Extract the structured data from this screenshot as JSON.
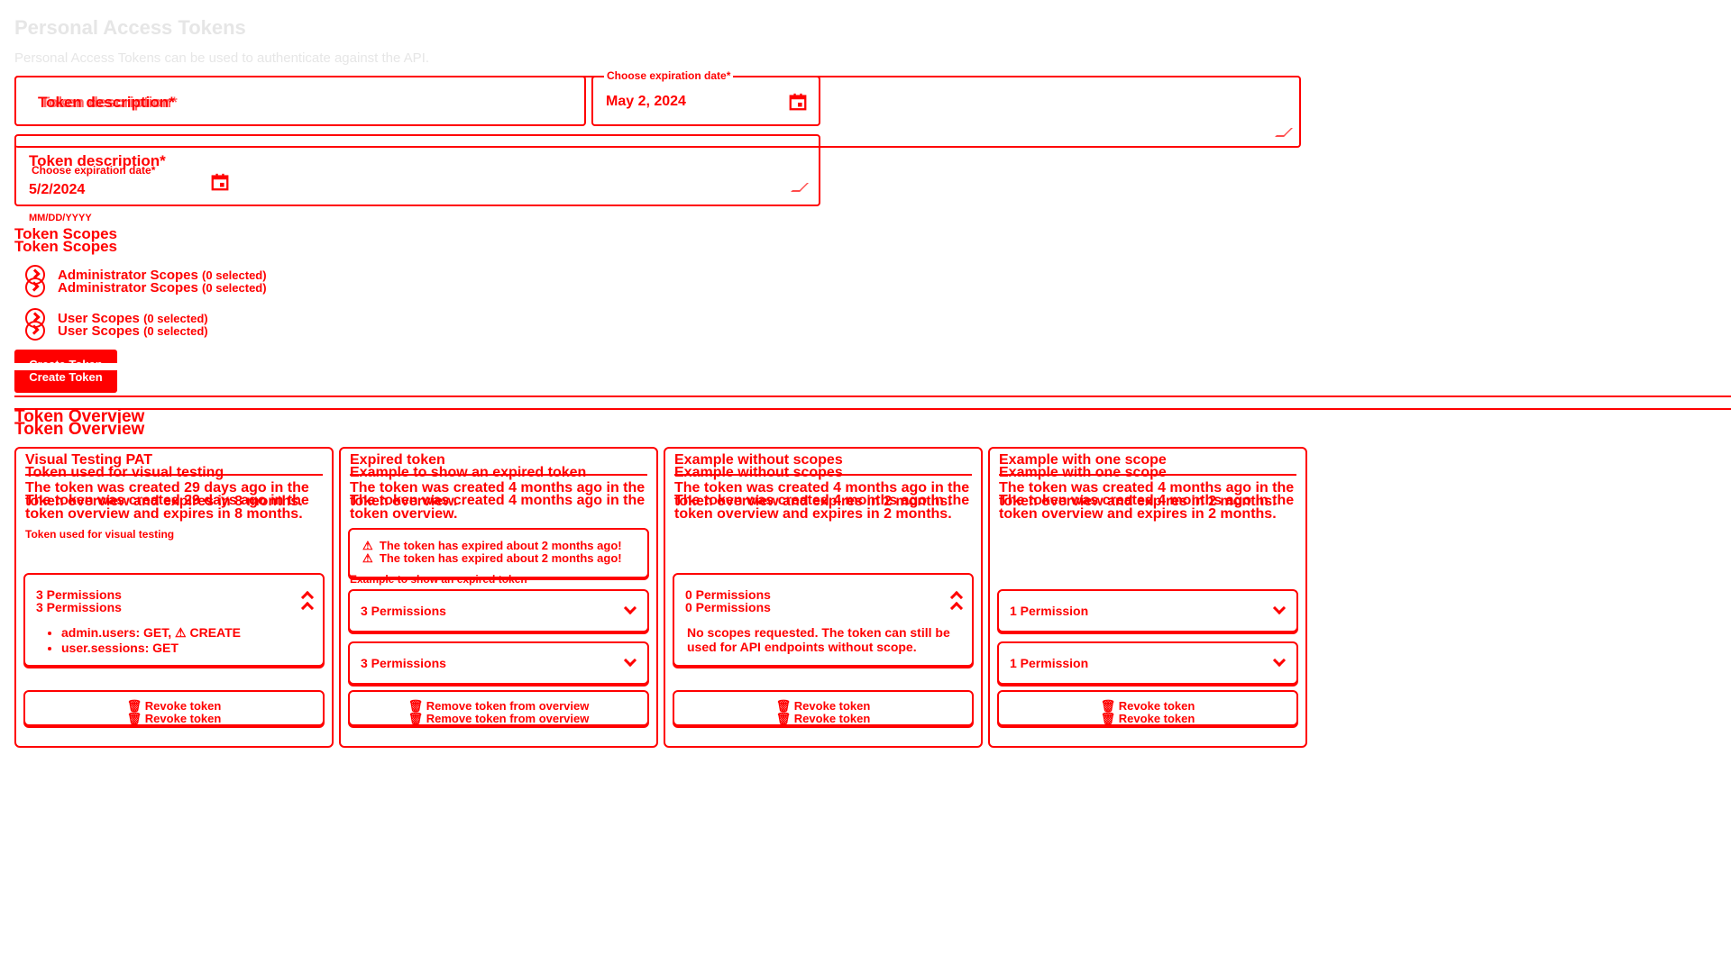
{
  "header": {
    "title": "Personal Access Tokens",
    "subtitle": "Personal Access Tokens can be used to authenticate against the API."
  },
  "form": {
    "description_label": "Token description*",
    "description_placeholder": "Token description*",
    "expiration_label": "Choose expiration date*",
    "expiration_value": "May 2, 2024",
    "expiration_value_short": "5/2/2024",
    "date_hint": "MM/DD/YYYY",
    "scopes_title": "Token Scopes",
    "admin_scopes": "Administrator Scopes",
    "admin_selected": "(0 selected)",
    "user_scopes": "User Scopes",
    "user_selected": "(0 selected)",
    "create_button": "Create Token"
  },
  "overview": {
    "title": "Token Overview",
    "tokens": [
      {
        "name": "Visual Testing PAT",
        "description": "Token used for visual testing",
        "created": "The token was created 29 days ago in the token overview and expires in 8 months.",
        "permissions": "3 Permissions",
        "permission_items": [
          "admin.users: GET, ⚠ CREATE",
          "user.sessions: GET"
        ],
        "action": "Revoke token"
      },
      {
        "name": "Expired token",
        "description": "Example to show an expired token",
        "created": "The token was created 4 months ago in the token overview.",
        "warning": "The token has expired about 2 months ago!",
        "permissions": "3 Permissions",
        "action": "Remove token from overview"
      },
      {
        "name": "Example without scopes",
        "description": "Example without scopes",
        "created": "The token was created 4 months ago in the token overview and expires in 2 months.",
        "permissions": "0 Permissions",
        "no_scope_text": "No scopes requested. The token can still be used for API endpoints without scope.",
        "action": "Revoke token"
      },
      {
        "name": "Example with one scope",
        "description": "Example with one scope",
        "created": "The token was created 4 months ago in the token overview and expires in 2 months.",
        "permissions": "1 Permission",
        "action": "Revoke token"
      }
    ]
  },
  "colors": {
    "accent": "#ff0000",
    "muted": "#e6e6e6",
    "background": "#ffffff"
  },
  "icons": {
    "calendar": "calendar-icon",
    "chevron": "chevron-icon",
    "warning": "warning-icon",
    "trash": "trash-icon"
  }
}
